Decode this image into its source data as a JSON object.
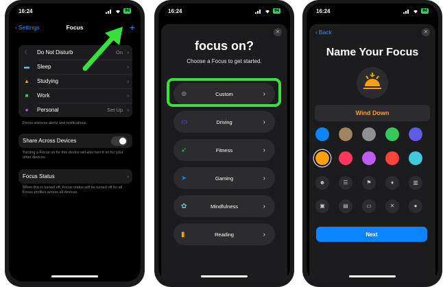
{
  "status": {
    "time": "16:24",
    "battery": "94"
  },
  "phone1": {
    "back_label": "Settings",
    "title": "Focus",
    "add_symbol": "+",
    "focus_modes": [
      {
        "label": "Do Not Disturb",
        "value": "On",
        "icon": "moon-icon",
        "color": "#7d5cff"
      },
      {
        "label": "Sleep",
        "value": "",
        "icon": "bed-icon",
        "color": "#5ac8fa"
      },
      {
        "label": "Studying",
        "value": "",
        "icon": "graduation-cap-icon",
        "color": "#ff9f0a"
      },
      {
        "label": "Work",
        "value": "",
        "icon": "work-icon",
        "color": "#34c759"
      },
      {
        "label": "Personal",
        "value": "Set Up",
        "icon": "person-icon",
        "color": "#bf5af2"
      }
    ],
    "modes_footer": "Focus silences alerts and notifications.",
    "share_label": "Share Across Devices",
    "share_footer": "Turning a Focus on for this device will also turn it on for your other devices.",
    "focus_status_label": "Focus Status",
    "status_footer": "When this is turned off, Focus status will be turned off for all Focus profiles across all devices."
  },
  "phone2": {
    "heading": "focus on?",
    "subheading": "Choose a Focus to get started.",
    "options": [
      {
        "label": "Custom",
        "icon": "plus-circle-icon",
        "color": "#8e8e93"
      },
      {
        "label": "Driving",
        "icon": "car-icon",
        "color": "#5e5ce6"
      },
      {
        "label": "Fitness",
        "icon": "running-icon",
        "color": "#34c759"
      },
      {
        "label": "Gaming",
        "icon": "rocket-icon",
        "color": "#0a84ff"
      },
      {
        "label": "Mindfulness",
        "icon": "flower-icon",
        "color": "#5ac8fa"
      },
      {
        "label": "Reading",
        "icon": "book-icon",
        "color": "#ff9f0a"
      }
    ],
    "close_symbol": "✕"
  },
  "phone3": {
    "back_label": "Back",
    "title": "Name Your Focus",
    "name_value": "Wind Down",
    "accent": "#ff9f0a",
    "colors": [
      "#0a84ff",
      "#a2845e",
      "#8e8e93",
      "#34c759",
      "#5e5ce6",
      "#ff9f0a",
      "#ff375f",
      "#bf5af2",
      "#ff453a",
      "#40c8e0"
    ],
    "glyphs": [
      {
        "name": "smiley-icon",
        "glyph": "☻"
      },
      {
        "name": "list-icon",
        "glyph": "☰"
      },
      {
        "name": "bookmark-icon",
        "glyph": "⚑"
      },
      {
        "name": "pin-icon",
        "glyph": "♦"
      },
      {
        "name": "books-icon",
        "glyph": "▥"
      },
      {
        "name": "gift-icon",
        "glyph": "▣"
      },
      {
        "name": "document-icon",
        "glyph": "▤"
      },
      {
        "name": "card-icon",
        "glyph": "▭"
      },
      {
        "name": "fork-knife-icon",
        "glyph": "✕"
      },
      {
        "name": "pills-icon",
        "glyph": "●"
      }
    ],
    "next_label": "Next",
    "close_symbol": "✕"
  }
}
